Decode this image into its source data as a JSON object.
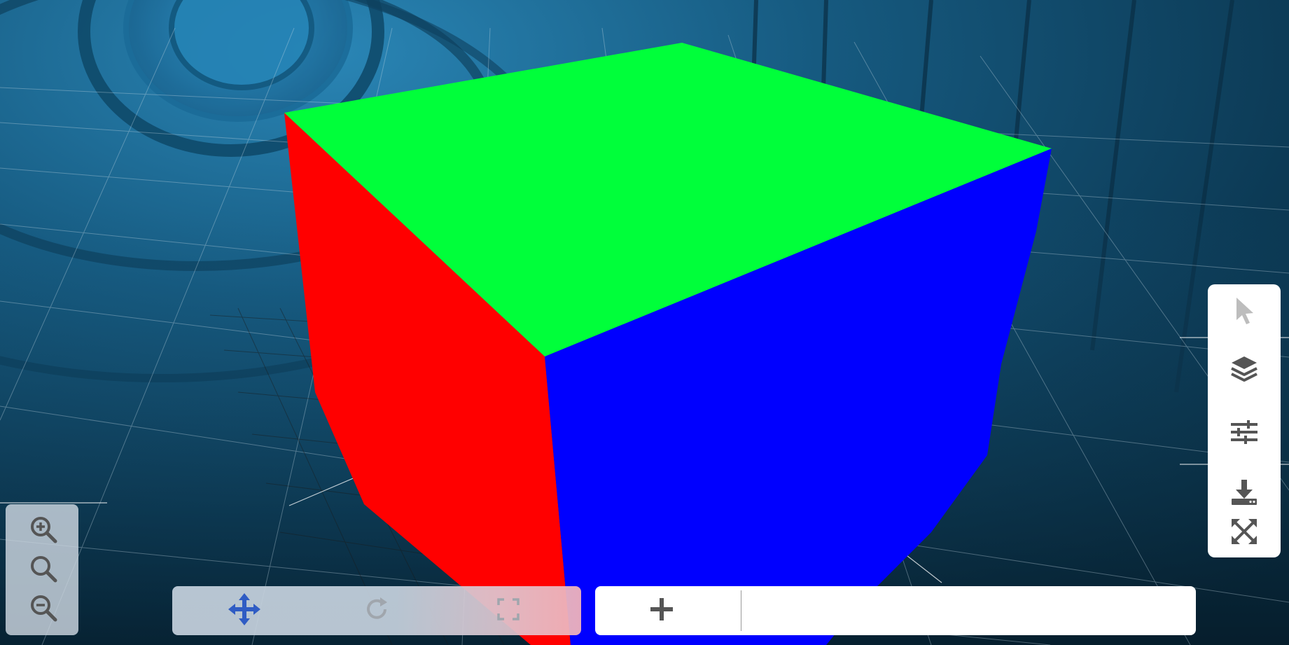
{
  "viewer": {
    "scene": "3d-cube-viewport",
    "cube_faces": {
      "top": "#00ff3a",
      "left": "#ff0000",
      "right": "#0000ff"
    },
    "background_color": "#0f4563"
  },
  "zoom_panel": {
    "buttons": [
      {
        "name": "zoom-in",
        "icon": "zoom-in-icon"
      },
      {
        "name": "zoom-fit",
        "icon": "magnifier-icon"
      },
      {
        "name": "zoom-out",
        "icon": "zoom-out-icon"
      }
    ]
  },
  "transform_toolbar": {
    "tools": [
      {
        "name": "move",
        "icon": "move-arrows-icon",
        "color": "#2f5cc4",
        "enabled": true
      },
      {
        "name": "rotate",
        "icon": "rotate-icon",
        "color": "#9aa0a6",
        "enabled": false
      },
      {
        "name": "scale",
        "icon": "bounding-box-icon",
        "color": "#9aa0a6",
        "enabled": false
      }
    ]
  },
  "add_bar": {
    "add_icon": "plus-icon"
  },
  "side_panel": {
    "buttons": [
      {
        "name": "select",
        "icon": "cursor-arrow-icon"
      },
      {
        "name": "layers",
        "icon": "layers-icon"
      },
      {
        "name": "settings",
        "icon": "sliders-icon"
      },
      {
        "name": "download",
        "icon": "download-icon"
      },
      {
        "name": "fullscreen",
        "icon": "fullscreen-expand-icon"
      }
    ]
  }
}
